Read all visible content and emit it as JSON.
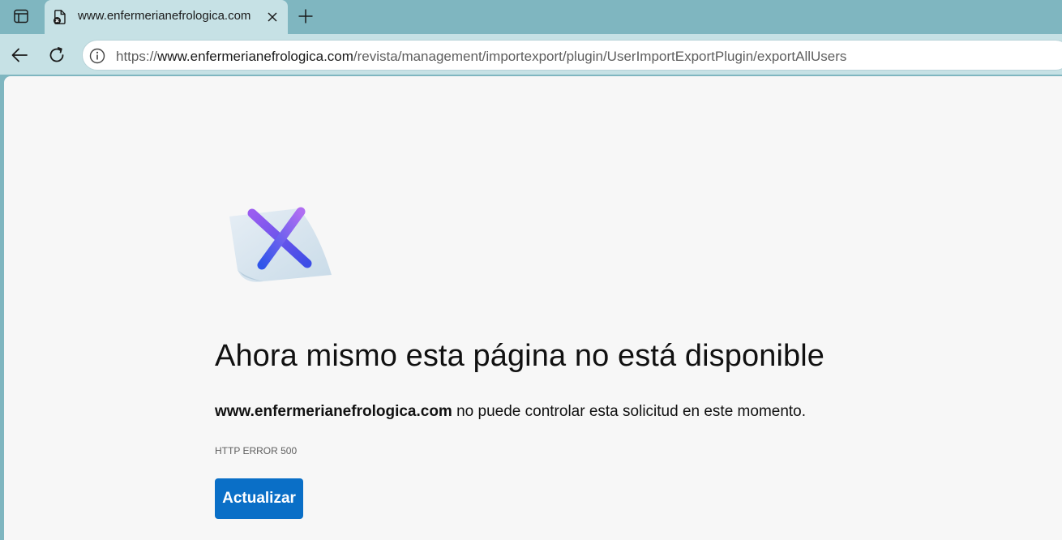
{
  "tab": {
    "title": "www.enfermerianefrologica.com",
    "favicon": "page-error-icon"
  },
  "toolbar": {
    "url_prefix": "https://",
    "url_host": "www.enfermerianefrologica.com",
    "url_path": "/revista/management/importexport/plugin/UserImportExportPlugin/exportAllUsers"
  },
  "error": {
    "illustration": "error-x-illustration",
    "title": "Ahora mismo esta página no está disponible",
    "host": "www.enfermerianefrologica.com",
    "message": " no puede controlar esta solicitud en este momento.",
    "code": "HTTP ERROR 500",
    "button_label": "Actualizar"
  },
  "colors": {
    "frame": "#7fb6c0",
    "toolbar": "#c6e1e5",
    "content_bg": "#f7f7f7",
    "button": "#0a6fc7"
  }
}
